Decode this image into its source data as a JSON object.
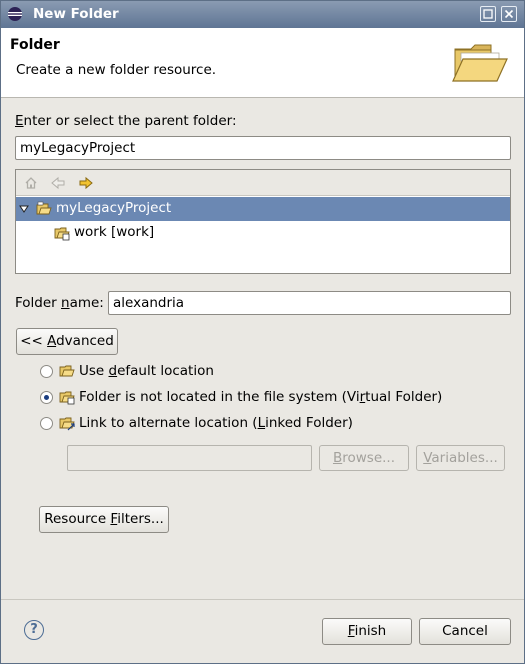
{
  "window": {
    "title": "New Folder"
  },
  "banner": {
    "title": "Folder",
    "description": "Create a new folder resource."
  },
  "parent_folder": {
    "label_before": "",
    "label_mnemonic": "E",
    "label_after": "nter or select the parent folder:",
    "value": "myLegacyProject"
  },
  "tree": {
    "items": [
      {
        "label": "myLegacyProject",
        "expanded": true,
        "selected": true
      },
      {
        "label": "work [work]",
        "expanded": false,
        "selected": false
      }
    ]
  },
  "folder_name": {
    "label_before": "Folder ",
    "label_mnemonic": "n",
    "label_after": "ame:",
    "value": "alexandria"
  },
  "advanced_button": {
    "before": "<< ",
    "mnemonic": "A",
    "after": "dvanced"
  },
  "options": [
    {
      "before": "Use ",
      "mnemonic": "d",
      "after": "efault location",
      "checked": false
    },
    {
      "before": "Folder is not located in the file system (Vi",
      "mnemonic": "r",
      "after": "tual Folder)",
      "checked": true
    },
    {
      "before": "Link to alternate location (",
      "mnemonic": "L",
      "after": "inked Folder)",
      "checked": false
    }
  ],
  "browse_button": {
    "before": "",
    "mnemonic": "B",
    "after": "rowse..."
  },
  "variables_button": {
    "before": "",
    "mnemonic": "V",
    "after": "ariables..."
  },
  "resource_filters_button": {
    "before": "Resource ",
    "mnemonic": "F",
    "after": "ilters..."
  },
  "footer": {
    "help_glyph": "?",
    "finish": {
      "before": "",
      "mnemonic": "F",
      "after": "inish"
    },
    "cancel": "Cancel"
  }
}
